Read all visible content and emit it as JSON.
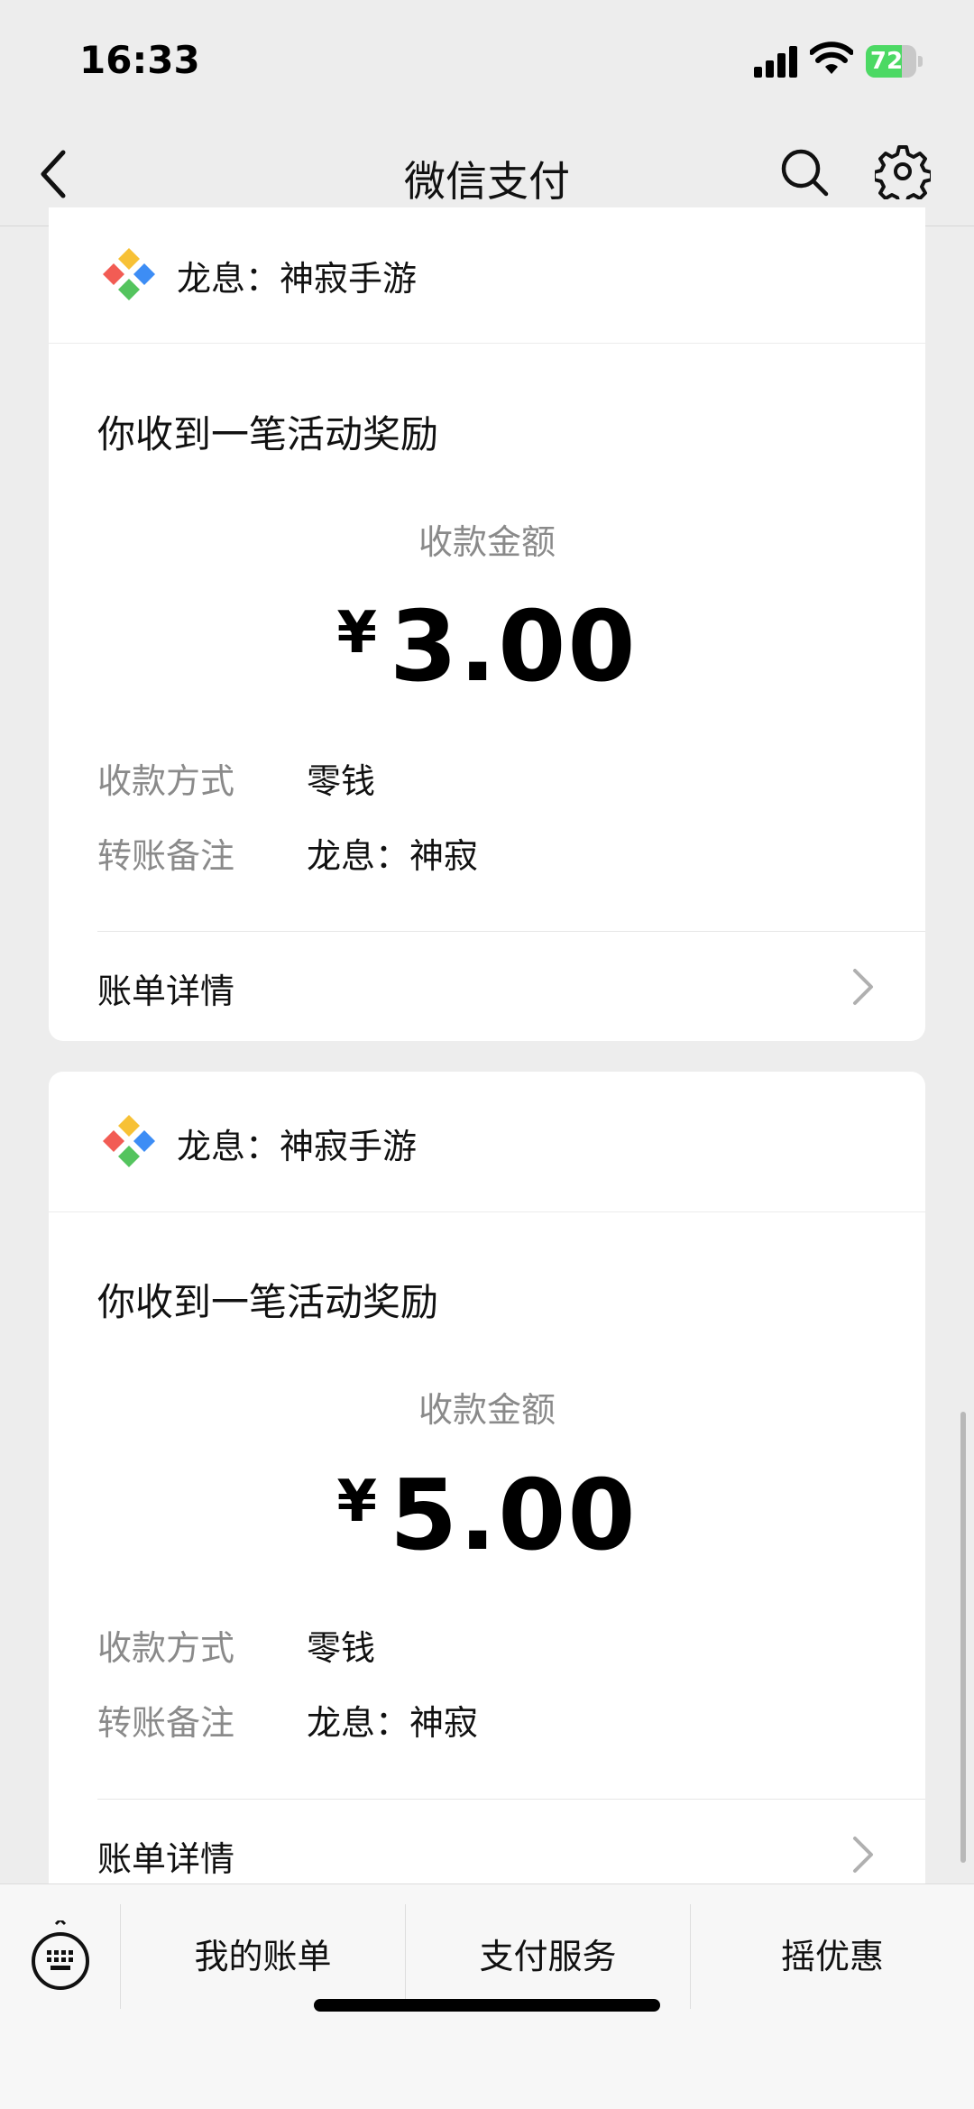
{
  "status_bar": {
    "time": "16:33",
    "battery": "72",
    "battery_level": 0.72
  },
  "nav": {
    "title": "微信支付"
  },
  "cards": [
    {
      "app_name": "龙息：神寂手游",
      "title": "你收到一笔活动奖励",
      "amount_label": "收款金额",
      "currency": "¥",
      "amount": "3.00",
      "method_label": "收款方式",
      "method_value": "零钱",
      "note_label": "转账备注",
      "note_value": "龙息：神寂",
      "detail_label": "账单详情"
    },
    {
      "app_name": "龙息：神寂手游",
      "title": "你收到一笔活动奖励",
      "amount_label": "收款金额",
      "currency": "¥",
      "amount": "5.00",
      "method_label": "收款方式",
      "method_value": "零钱",
      "note_label": "转账备注",
      "note_value": "龙息：神寂",
      "detail_label": "账单详情"
    }
  ],
  "bottom_bar": {
    "items": [
      "我的账单",
      "支付服务",
      "摇优惠"
    ]
  },
  "colors": {
    "background": "#ededed",
    "card": "#ffffff",
    "battery": "#4cd964",
    "logo_red": "#f25c54",
    "logo_blue": "#3d8df5",
    "logo_yellow": "#f7c136",
    "logo_green": "#54c45e"
  }
}
